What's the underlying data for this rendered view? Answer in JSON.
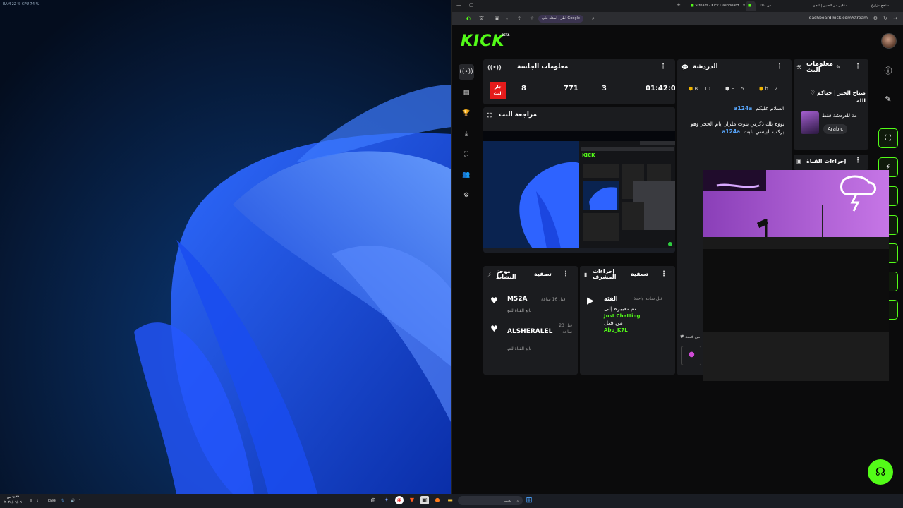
{
  "desktop": {
    "top_left_text": "RAM 22 %  CPU 74 %"
  },
  "browser": {
    "tabs": [
      {
        "label": "منتجع مزارع ...",
        "active": false
      },
      {
        "label": "مناقير من الصين | الجو",
        "active": false
      },
      {
        "label": "بس ملك...",
        "active": false
      },
      {
        "label": "Stream - Kick Dashboard",
        "active": true
      }
    ],
    "url": "dashboard.kick.com/stream",
    "google_chip": "اطرح أسئلة على Google"
  },
  "kick": {
    "logo": "KICK",
    "beta": "BETA",
    "left_nav": [
      {
        "icon": "broadcast-icon",
        "glyph": "((•))"
      },
      {
        "icon": "analytics-icon",
        "glyph": "▤"
      },
      {
        "icon": "trophy-icon",
        "glyph": "🏆"
      },
      {
        "icon": "download-icon",
        "glyph": "⤓"
      },
      {
        "icon": "screen-icon",
        "glyph": "⛶"
      },
      {
        "icon": "users-icon",
        "glyph": "👥"
      },
      {
        "icon": "settings-icon",
        "glyph": "⚙"
      }
    ],
    "session": {
      "title": "معلومات الجلسة",
      "live_label": "جار البث",
      "stats": [
        "8",
        "771",
        "3",
        "01:42:03"
      ]
    },
    "chat": {
      "title": "الدردشة",
      "badges": [
        {
          "label": "B...",
          "count": "10"
        },
        {
          "label": "H...",
          "count": "5"
        },
        {
          "label": "b...",
          "count": "2"
        }
      ],
      "messages": [
        {
          "user": "a124a",
          "text": "السلام عليكم"
        },
        {
          "user": "a124a",
          "text": "بووه بلك ذكرني بتوث ملزاز ايام الحجر وهو يركب البيسي بلبث"
        }
      ],
      "footer": "من فضة"
    },
    "stream_info": {
      "title": "معلومات البث",
      "stream_title": "صباح الخير | حياكم ♡ الله",
      "category_text": "مة للدردشة فقط",
      "tag": "Arabic"
    },
    "channel_actions": {
      "title": "إجراءات القناة"
    },
    "preview": {
      "title": "مراجعة البث"
    },
    "activity": {
      "title": "موجز النشاط",
      "filter": "تصفية",
      "items": [
        {
          "name": "M52A",
          "time": "قبل 16 ساعة",
          "sub": "تابع القناة للتو"
        },
        {
          "name": "ALSHERALEL",
          "time": "قبل 23 ساعة",
          "sub": "تابع القناة للتو"
        }
      ]
    },
    "moderator": {
      "title": "إجراءات المشرف",
      "filter": "تصفية",
      "item": {
        "label": "الفئة",
        "time": "قبل ساعة واحدة",
        "prefix": "تم تغييره إلى",
        "value": "Just Chatting",
        "by_prefix": "من قبل",
        "by": "Abu_K7L"
      }
    }
  },
  "taskbar": {
    "left_time": "٩:٣٣ ص",
    "left_date": "٢٠٢٤/٠٩/٠٦",
    "lang": "ENG",
    "search_placeholder": "بحث"
  }
}
